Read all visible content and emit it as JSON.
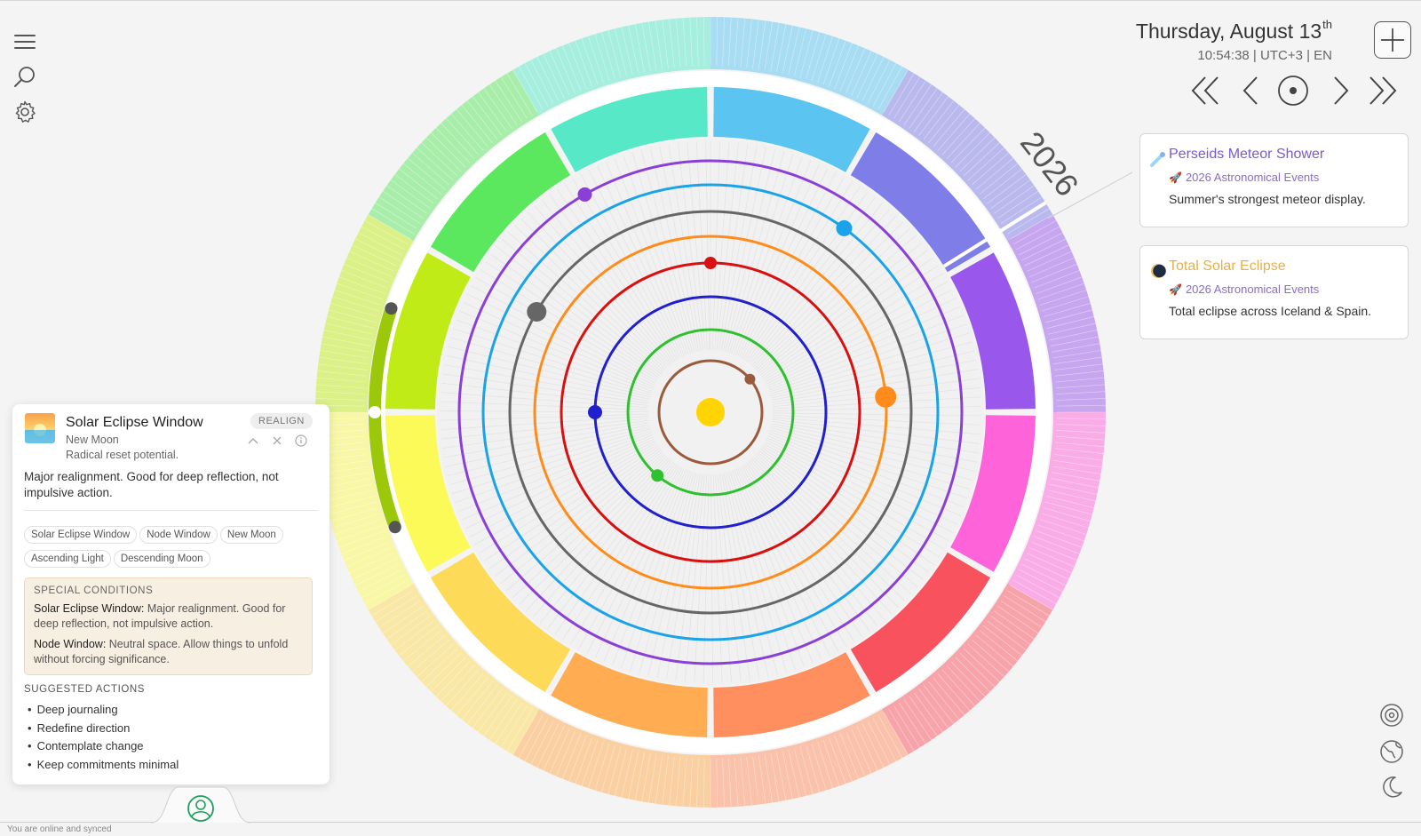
{
  "header": {
    "date": "Thursday, August 13",
    "date_suffix": "th",
    "time_line": "10:54:38 | UTC+3 | EN"
  },
  "wheel": {
    "year_label": "2026"
  },
  "events": [
    {
      "title": "Perseids Meteor Shower",
      "calendar": "2026 Astronomical Events",
      "description": "Summer's strongest meteor display.",
      "icon": "meteor-icon",
      "title_color": "#7a5bd0"
    },
    {
      "title": "Total Solar Eclipse",
      "calendar": "2026 Astronomical Events",
      "description": "Total eclipse across Iceland & Spain.",
      "icon": "eclipse-icon",
      "title_color": "#e8b04b"
    }
  ],
  "panel": {
    "title": "Solar Eclipse Window",
    "phase": "New Moon",
    "subtitle": "Radical reset potential.",
    "badge": "REALIGN",
    "text": "Major realignment. Good for deep reflection, not impulsive action.",
    "tags": [
      "Solar Eclipse Window",
      "Node Window",
      "New Moon",
      "Ascending Light",
      "Descending Moon"
    ],
    "special_heading": "SPECIAL CONDITIONS",
    "special": [
      {
        "name": "Solar Eclipse Window:",
        "text": " Major realignment. Good for deep reflection, not impulsive action."
      },
      {
        "name": "Node Window:",
        "text": " Neutral space. Allow things to unfold without forcing significance."
      }
    ],
    "suggested_heading": "SUGGESTED ACTIONS",
    "suggested": [
      "Deep journaling",
      "Redefine direction",
      "Contemplate change",
      "Keep commitments minimal"
    ]
  },
  "status": "You are online and synced",
  "icons": [
    "menu-icon",
    "search-icon",
    "gear-icon",
    "plus-icon",
    "double-chevron-left-icon",
    "chevron-left-icon",
    "today-icon",
    "chevron-right-icon",
    "double-chevron-right-icon",
    "profile-icon",
    "planets-icon",
    "globe-icon",
    "moon-icon"
  ],
  "colors": {
    "months": [
      "#5bc4f0",
      "#7f7ee8",
      "#9a57ec",
      "#ff63da",
      "#f9525f",
      "#ff8f5f",
      "#ffac52",
      "#fdda58",
      "#fbfa58",
      "#c1eb17",
      "#5be85f",
      "#57e8c7"
    ],
    "orbits": [
      "#9b5a3b",
      "#2fc02f",
      "#2020cc",
      "#d81010",
      "#ff8c1a",
      "#666666",
      "#1aa3e8",
      "#8a3fd6"
    ],
    "sun": "#ffd400"
  }
}
